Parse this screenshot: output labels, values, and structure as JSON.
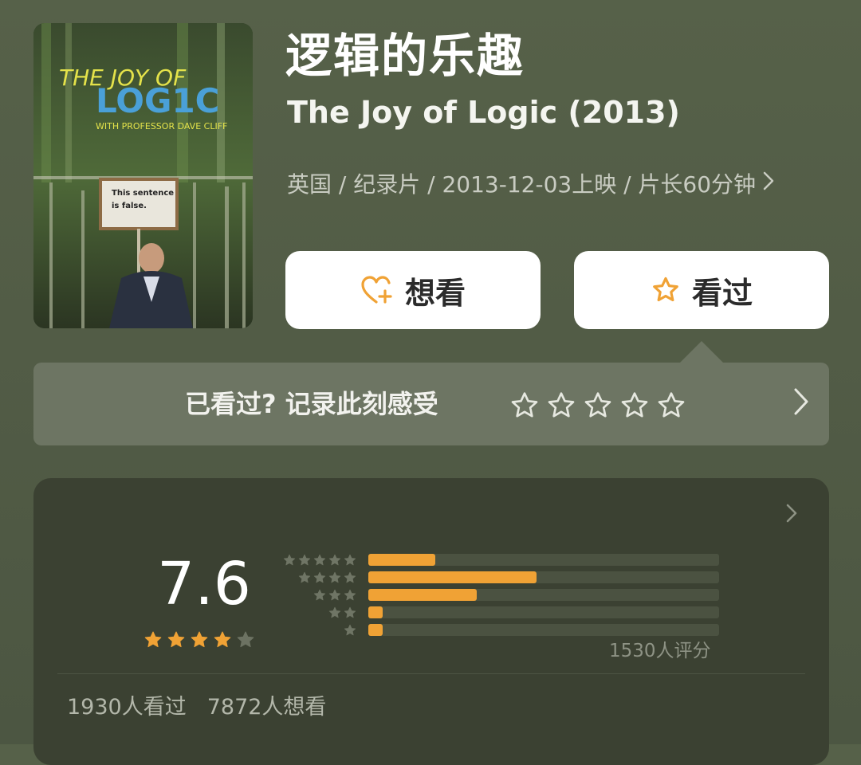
{
  "movie": {
    "title_cn": "逻辑的乐趣",
    "title_en": "The Joy of Logic (2013)",
    "meta": "英国 / 纪录片 / 2013-12-03上映 / 片长60分钟"
  },
  "poster": {
    "line1": "THE JOY OF",
    "line2": "LOG1C",
    "line3": "WITH PROFESSOR DAVE CLIFF",
    "sign_line1": "This sentence",
    "sign_line2": "is false."
  },
  "actions": {
    "want_label": "想看",
    "seen_label": "看过"
  },
  "rate_prompt": {
    "text": "已看过? 记录此刻感受",
    "max_stars": 5
  },
  "rating": {
    "score": "7.6",
    "stars_filled": 4,
    "stars_total": 5,
    "distribution": [
      {
        "stars": 5,
        "fraction": 0.19
      },
      {
        "stars": 4,
        "fraction": 0.48
      },
      {
        "stars": 3,
        "fraction": 0.31
      },
      {
        "stars": 2,
        "fraction": 0.04
      },
      {
        "stars": 1,
        "fraction": 0.04
      }
    ],
    "raters_text": "1530人评分"
  },
  "stats": {
    "seen": "1930人看过",
    "want": "7872人想看"
  },
  "colors": {
    "background": "#525c46",
    "accent": "#f0a235",
    "card": "#3b4132",
    "rate_box": "#6d7563"
  }
}
